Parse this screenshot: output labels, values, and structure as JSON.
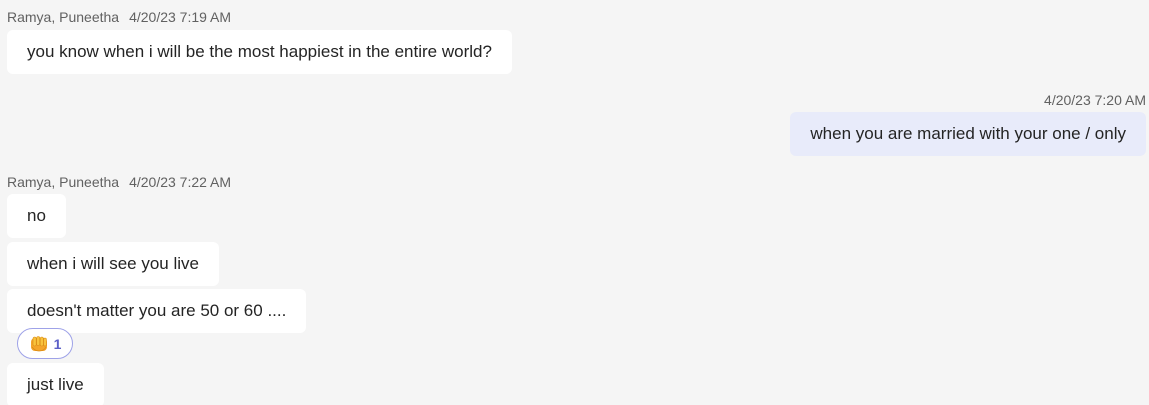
{
  "messages": [
    {
      "author": "Ramya, Puneetha",
      "timestamp": "4/20/23 7:19 AM",
      "texts": [
        "you know when i will be the most happiest in the entire world?"
      ]
    },
    {
      "author": "",
      "timestamp": "4/20/23 7:20 AM",
      "texts": [
        "when you are married with your one / only"
      ]
    },
    {
      "author": "Ramya, Puneetha",
      "timestamp": "4/20/23 7:22 AM",
      "texts": [
        "no",
        "when i will see you live",
        "doesn't matter you are 50 or 60 ....",
        "just live"
      ]
    }
  ],
  "reaction": {
    "icon": "fist-bump-icon",
    "count": "1"
  },
  "colors": {
    "background": "#f5f5f5",
    "incoming_bubble": "#ffffff",
    "outgoing_bubble": "#e8ebfa",
    "reaction_accent": "#5b5fc7"
  }
}
